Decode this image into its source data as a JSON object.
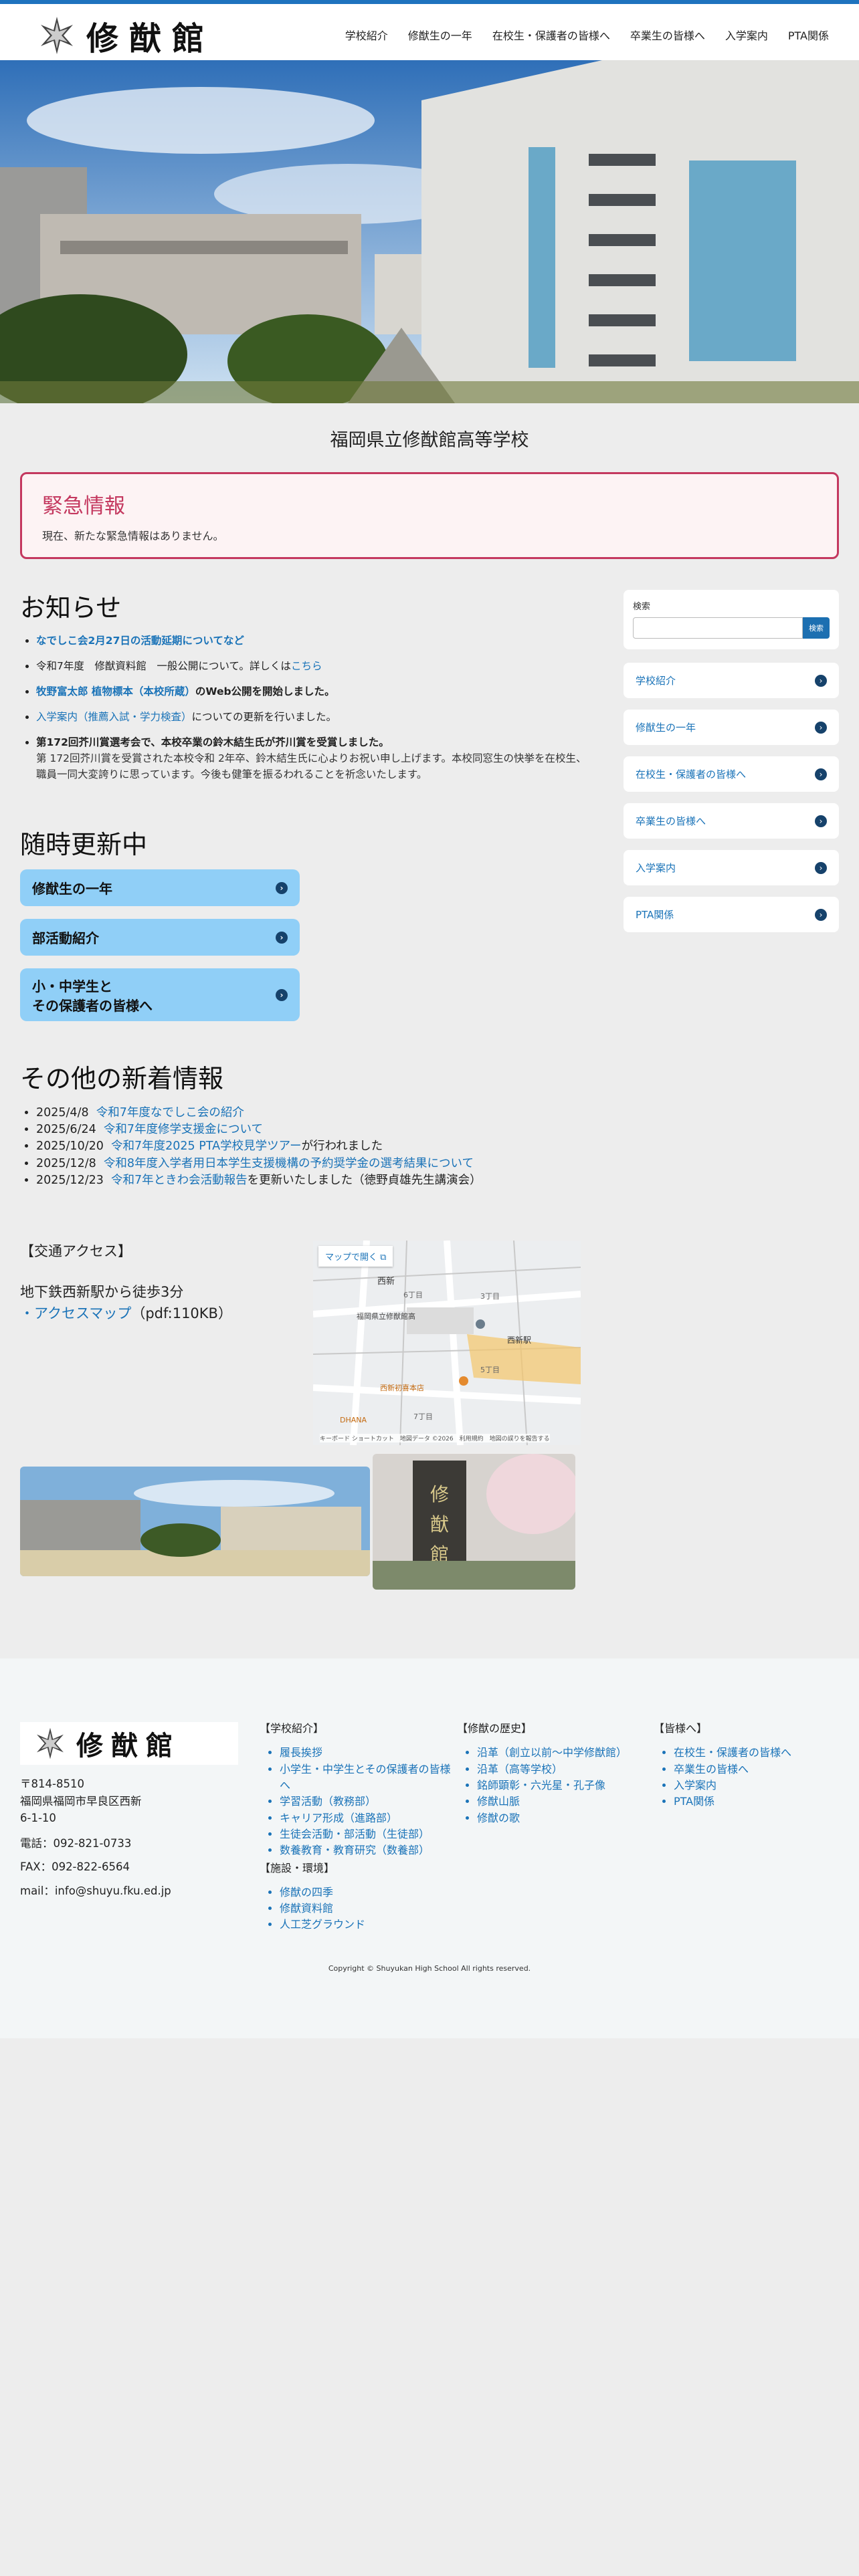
{
  "header": {
    "logo_text": "修猷館",
    "nav": [
      "学校紹介",
      "修猷生の一年",
      "在校生・保護者の皆様へ",
      "卒業生の皆様へ",
      "入学案内",
      "PTA関係"
    ]
  },
  "school_name": "福岡県立修猷館高等学校",
  "alert": {
    "title": "緊急情報",
    "text": "現在、新たな緊急情報はありません。"
  },
  "news": {
    "title": "お知らせ",
    "item1_link": "なでしこ会2月27日の活動延期についてなど",
    "item2_text": "令和7年度　修猷資料館　一般公開について。詳しくは",
    "item2_link": "こちら",
    "item3_link": "牧野富太郎 植物標本（本校所蔵）",
    "item3_text": "のWeb公開を開始しました。",
    "item4_link": "入学案内（推薦入試・学力検査）",
    "item4_text": "についての更新を行いました。",
    "item5_title": "第172回芥川賞選考会で、本校卒業の鈴木結生氏が芥川賞を受賞しました。",
    "item5_sub": "第 172回芥川賞を受賞された本校令和 2年卒、鈴木結生氏に心よりお祝い申し上げます。本校同窓生の快挙を在校生、職員一同大変誇りに思っています。今後も健筆を振るわれることを祈念いたします。"
  },
  "updates": {
    "title": "随時更新中",
    "btn1": "修猷生の一年",
    "btn2": "部活動紹介",
    "btn3_line1": "小・中学生と",
    "btn3_line2": "その保護者の皆様へ"
  },
  "other_news": {
    "title": "その他の新着情報",
    "items": [
      {
        "date": "2025/4/8",
        "link": "令和7年度なでしこ会の紹介",
        "text": ""
      },
      {
        "date": "2025/6/24",
        "link": "令和7年度修学支援金について",
        "text": ""
      },
      {
        "date": "2025/10/20",
        "link": "令和7年度2025 PTA学校見学ツアー",
        "text": "が行われました"
      },
      {
        "date": "2025/12/8",
        "link": "令和8年度入学者用日本学生支援機構の予約奨学金の選考結果について",
        "text": ""
      },
      {
        "date": "2025/12/23",
        "link": "令和7年ときわ会活動報告",
        "text": "を更新いたしました（徳野貞雄先生講演会）"
      }
    ]
  },
  "access": {
    "title": "【交通アクセス】",
    "line1": "地下鉄西新駅から徒歩3分",
    "map_link": "・アクセスマップ",
    "map_link_note": "（pdf:110KB）",
    "map_button": "マップで開く",
    "map_labels": [
      "西新",
      "福岡県立修猷館高",
      "西新初喜本店",
      "西新駅",
      "DHANA",
      "6丁目",
      "5丁目",
      "7丁目",
      "3丁目"
    ],
    "map_attribution": "キーボード ショートカット　地図データ ©2026　利用規約　地図の誤りを報告する"
  },
  "sidebar": {
    "search_label": "検索",
    "search_button": "検索",
    "items": [
      "学校紹介",
      "修猷生の一年",
      "在校生・保護者の皆様へ",
      "卒業生の皆様へ",
      "入学案内",
      "PTA関係"
    ]
  },
  "footer": {
    "logo_text": "修猷館",
    "postal": "〒814-8510",
    "address1": "福岡県福岡市早良区西新",
    "address2": "6-1-10",
    "tel": "電話：092-821-0733",
    "fax": "FAX：092-822-6564",
    "mail": "mail：info@shuyu.fku.ed.jp",
    "col1_title": "【学校紹介】",
    "col1_items": [
      "履長挨拶",
      "小学生・中学生とその保護者の皆様へ",
      "学習活動（教務部）",
      "キャリア形成（進路部）",
      "生徒会活動・部活動（生徒部）",
      "数養教育・教育研究（数養部）"
    ],
    "col1b_title": "【施設・環境】",
    "col1b_items": [
      "修猷の四季",
      "修猷資料館",
      "人工芝グラウンド"
    ],
    "col2_title": "【修猷の歴史】",
    "col2_items": [
      "沿革（創立以前〜中学修猷館）",
      "沿革（高等学校）",
      "銘師顕彰・六光星・孔子像",
      "修猷山脈",
      "修猷の歌"
    ],
    "col3_title": "【皆様へ】",
    "col3_items": [
      "在校生・保護者の皆様へ",
      "卒業生の皆様へ",
      "入学案内",
      "PTA関係"
    ],
    "copyright": "Copyright © Shuyukan High School All rights reserved."
  },
  "colors": {
    "accent": "#1e73be",
    "alert": "#c4385f",
    "button": "#90cff7",
    "link": "#1a73b8"
  }
}
